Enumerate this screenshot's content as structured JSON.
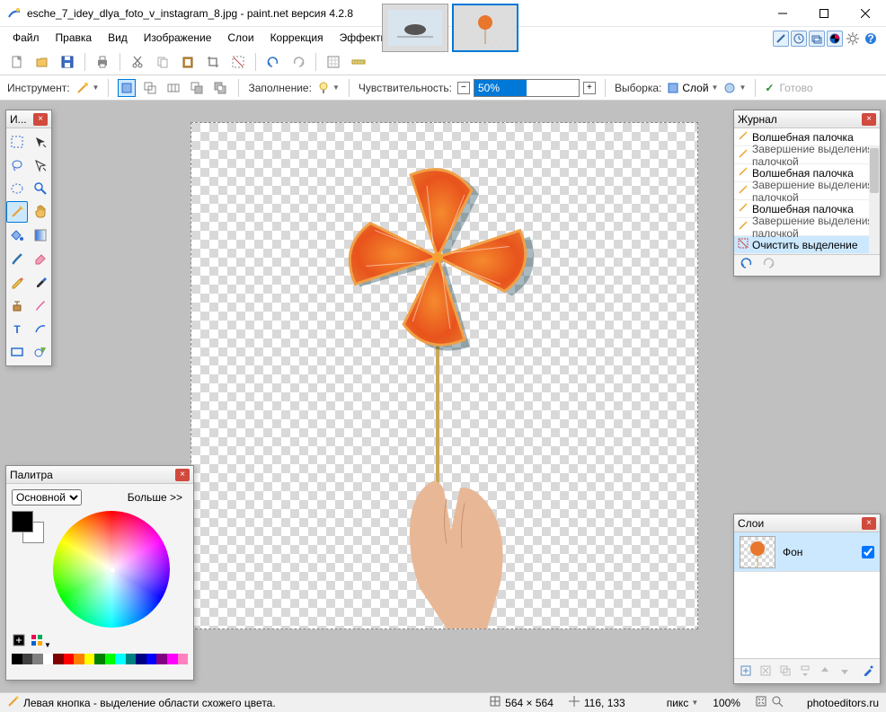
{
  "title": "esche_7_idey_dlya_foto_v_instagram_8.jpg - paint.net версия 4.2.8",
  "menu": [
    "Файл",
    "Правка",
    "Вид",
    "Изображение",
    "Слои",
    "Коррекция",
    "Эффекты"
  ],
  "options": {
    "instrument_label": "Инструмент:",
    "fill_label": "Заполнение:",
    "tolerance_label": "Чувствительность:",
    "tolerance_value": "50%",
    "sample_label": "Выборка:",
    "sample_value": "Слой",
    "finish_label": "Готово"
  },
  "panels": {
    "tools_title": "И...",
    "history_title": "Журнал",
    "palette_title": "Палитра",
    "layers_title": "Слои"
  },
  "history": {
    "items": [
      {
        "label": "Волшебная палочка",
        "type": "main"
      },
      {
        "label": "Завершение выделения палочкой",
        "type": "sub"
      },
      {
        "label": "Волшебная палочка",
        "type": "main"
      },
      {
        "label": "Завершение выделения палочкой",
        "type": "sub"
      },
      {
        "label": "Волшебная палочка",
        "type": "main"
      },
      {
        "label": "Завершение выделения палочкой",
        "type": "sub"
      },
      {
        "label": "Очистить выделение",
        "type": "sel"
      }
    ]
  },
  "palette": {
    "mode": "Основной",
    "more": "Больше >>"
  },
  "layers": {
    "bg": "Фон"
  },
  "status": {
    "hint": "Левая кнопка - выделение области схожего цвета.",
    "dims": "564 × 564",
    "cursor": "116, 133",
    "unit": "пикс",
    "zoom": "100%",
    "brand": "photoeditors.ru"
  },
  "colors": {
    "accent": "#0078d7"
  },
  "swatch_colors": [
    "#000",
    "#404040",
    "#808080",
    "#fff",
    "#800000",
    "#f00",
    "#ff8000",
    "#ff0",
    "#008000",
    "#0f0",
    "#00ffff",
    "#008080",
    "#000080",
    "#00f",
    "#800080",
    "#f0f",
    "#ff80c0"
  ]
}
